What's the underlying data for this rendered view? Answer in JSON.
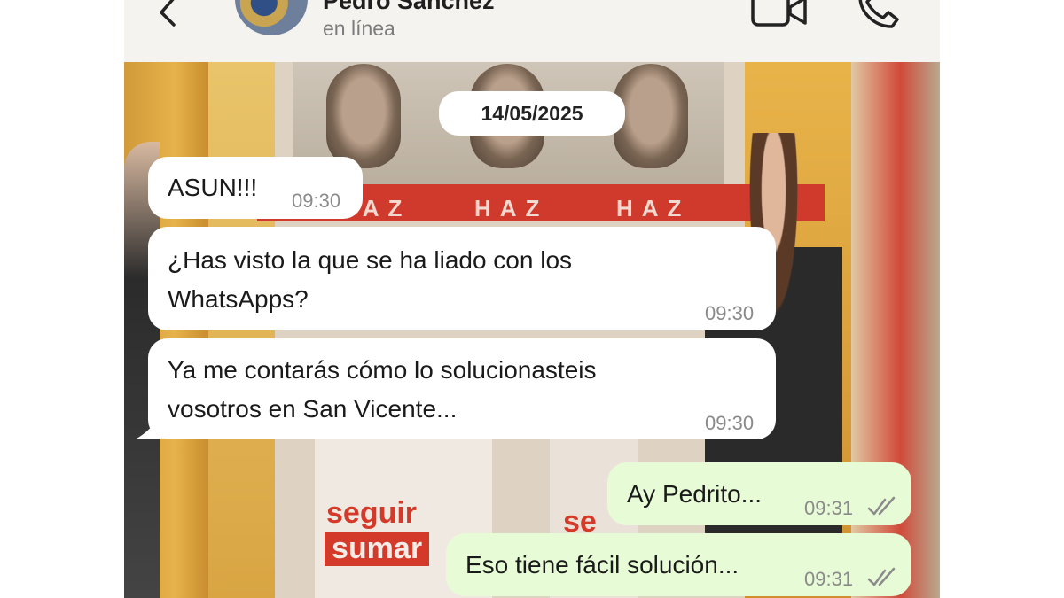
{
  "header": {
    "contact_name": "Pedro Sánchez",
    "status": "en línea"
  },
  "chat": {
    "date": "14/05/2025",
    "messages": [
      {
        "direction": "in",
        "lines": [
          "ASUN!!!"
        ],
        "time": "09:30"
      },
      {
        "direction": "in",
        "lines": [
          "¿Has visto la que se ha liado con los",
          "WhatsApps?"
        ],
        "time": "09:30"
      },
      {
        "direction": "in",
        "lines": [
          "Ya me contarás cómo lo solucionasteis",
          "vosotros en San Vicente..."
        ],
        "time": "09:30"
      },
      {
        "direction": "out",
        "lines": [
          "Ay Pedrito..."
        ],
        "time": "09:31",
        "status": "read"
      },
      {
        "direction": "out",
        "lines": [
          "Eso tiene fácil solución..."
        ],
        "time": "09:31",
        "status": "read"
      }
    ]
  },
  "background": {
    "poster_word": "HAZ",
    "slogan_top": "seguir",
    "slogan_bottom": "sumar",
    "slogan_partial": "se"
  },
  "icons": {
    "back": "back-arrow-icon",
    "video": "video-call-icon",
    "call": "phone-call-icon",
    "read": "double-check-icon"
  },
  "colors": {
    "incoming_bubble": "#ffffff",
    "outgoing_bubble": "#e7fbd6",
    "header_bg": "#f4f3ef",
    "poster_red": "#cf3a2c"
  }
}
